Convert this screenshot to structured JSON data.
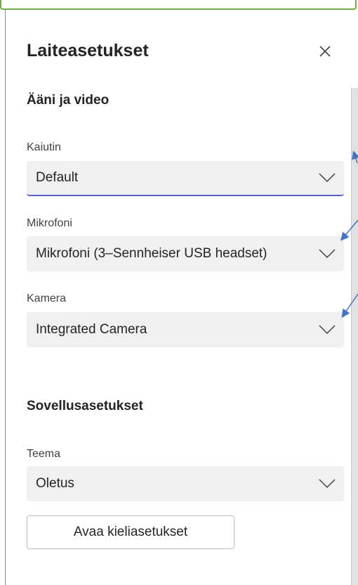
{
  "panel": {
    "title": "Laiteasetukset",
    "close_icon": "close-icon"
  },
  "audio_video": {
    "heading": "Ääni ja video",
    "speaker": {
      "label": "Kaiutin",
      "value": "Default"
    },
    "microphone": {
      "label": "Mikrofoni",
      "value": "Mikrofoni (3–Sennheiser USB headset)"
    },
    "camera": {
      "label": "Kamera",
      "value": "Integrated Camera"
    }
  },
  "app_settings": {
    "heading": "Sovellusasetukset",
    "theme": {
      "label": "Teema",
      "value": "Oletus"
    },
    "language_button": "Avaa kieliasetukset"
  },
  "colors": {
    "accent": "#5b5fc7",
    "annotation_arrow": "#4472c4",
    "window_border": "#70ad47"
  }
}
